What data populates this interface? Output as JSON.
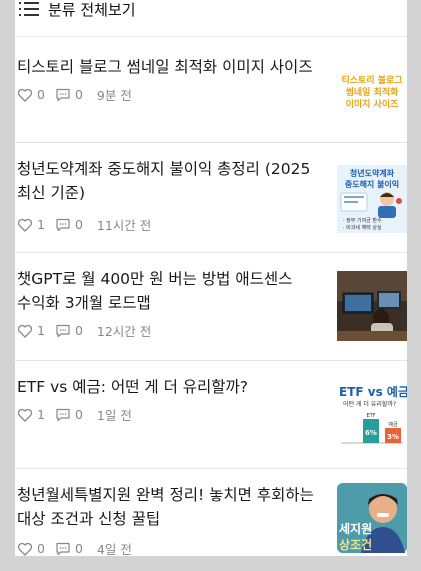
{
  "header": {
    "title": "분류 전체보기"
  },
  "posts": [
    {
      "title": "티스토리 블로그 썸네일 최적화 이미지 사이즈",
      "likes": "0",
      "comments": "0",
      "time": "9분 전",
      "thumb_lines": [
        "티스토리 블로그",
        "썸네일 최적화",
        "이미지 사이즈"
      ],
      "thumb_color": "#e8a317"
    },
    {
      "title": "청년도약계좌 중도해지 불이익 총정리 (2025 최신 기준)",
      "likes": "1",
      "comments": "0",
      "time": "11시간 전",
      "thumb_lines": [
        "청년도약계좌",
        "중도해지 불이익"
      ],
      "thumb_caption": [
        "· 정부 기여금 환수",
        "· 비과세 혜택 상실"
      ],
      "thumb_color": "#1f5fa8"
    },
    {
      "title": "챗GPT로 월 400만 원 버는 방법 애드센스 수익화 3개월 로드맵",
      "likes": "1",
      "comments": "0",
      "time": "12시간 전"
    },
    {
      "title": "ETF vs 예금: 어떤 게 더 유리할까?",
      "likes": "1",
      "comments": "0",
      "time": "1일 전",
      "thumb_head": "ETF vs 예금",
      "thumb_sub": "어떤 게 더 유리할까?",
      "thumb_bar1": "ETF",
      "thumb_bar2": "예금",
      "thumb_val1": "6%",
      "thumb_val2": "3%"
    },
    {
      "title": "청년월세특별지원 완벽 정리! 놓치면 후회하는 대상 조건과 신청 꿀팁",
      "likes": "0",
      "comments": "0",
      "time": "4일 전",
      "thumb_lines": [
        "세지원",
        "상조건"
      ]
    }
  ],
  "icons": {
    "like": "heart-icon",
    "comment": "comment-icon",
    "menu": "menu-icon"
  }
}
